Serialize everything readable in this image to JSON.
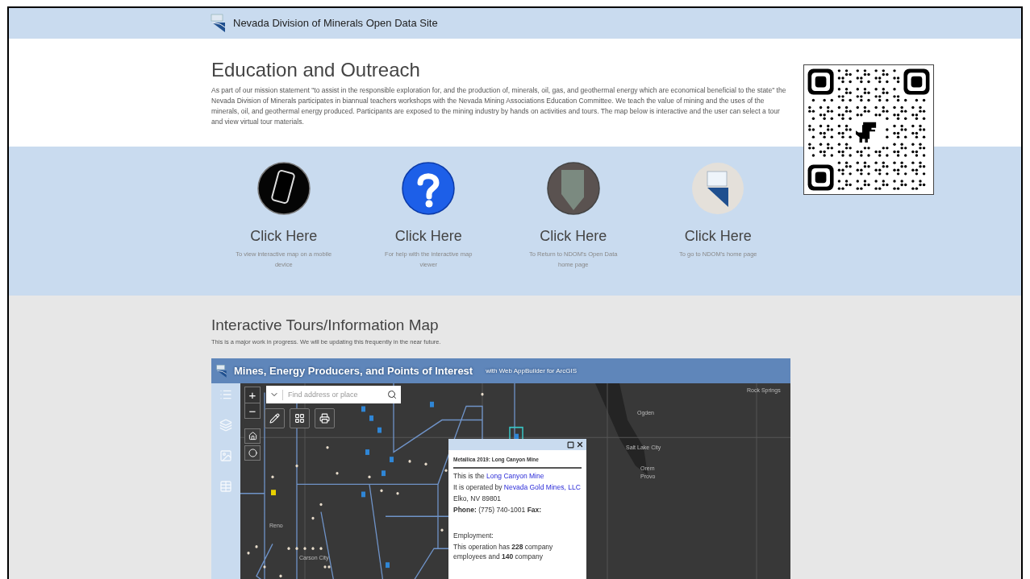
{
  "header": {
    "title": "Nevada Division of Minerals Open Data Site"
  },
  "intro": {
    "heading": "Education and Outreach",
    "body": "As part of our mission statement \"to assist in the responsible exploration for, and the production of, minerals, oil, gas, and geothermal energy which are economical beneficial to the state\" the Nevada Division of Minerals participates in biannual teachers workshops with the Nevada Mining Associations Education Committee. We teach the value of mining and the uses of the minerals, oil, and geothermal energy produced. Participants are exposed to the mining industry by hands on activities and tours. The map below is interactive and the user can select a tour and view virtual tour materials."
  },
  "links": [
    {
      "kind": "phone",
      "title": "Click Here",
      "caption": "To view interactive map on a mobile device"
    },
    {
      "kind": "help",
      "title": "Click Here",
      "caption": "For help with the interactive map viewer"
    },
    {
      "kind": "photo",
      "title": "Click Here",
      "caption": "To Return to NDOM's Open Data home page"
    },
    {
      "kind": "logo",
      "title": "Click Here",
      "caption": "To go to NDOM's home page"
    }
  ],
  "map_section": {
    "heading": "Interactive Tours/Information Map",
    "note": "This is a major work in progress. We will be updating this frequently in the near future."
  },
  "map_app": {
    "title": "Mines, Energy Producers, and Points of Interest",
    "subtitle": "with Web AppBuilder for ArcGIS",
    "zoom_in": "+",
    "zoom_out": "−",
    "search_placeholder": "Find address or place",
    "labels": [
      "Reno",
      "Carson City",
      "Ogden",
      "Salt Lake City",
      "Orem",
      "Provo",
      "Rock Springs"
    ]
  },
  "popup": {
    "title": "Metallica 2019: Long Canyon Mine",
    "lines": [
      {
        "kind": "link",
        "text": "This is the ",
        "link": "Long Canyon Mine"
      },
      {
        "kind": "link",
        "text": "It is operated by ",
        "link": "Nevada Gold Mines, LLC"
      },
      {
        "kind": "text",
        "text": "Elko, NV 89801"
      },
      {
        "kind": "text",
        "text": "**Phone:** (775) 740-1001 **Fax:**"
      },
      {
        "kind": "gap",
        "text": "Employment:"
      },
      {
        "kind": "text",
        "text": "This operation has **228** company employees and **140** company"
      }
    ]
  }
}
